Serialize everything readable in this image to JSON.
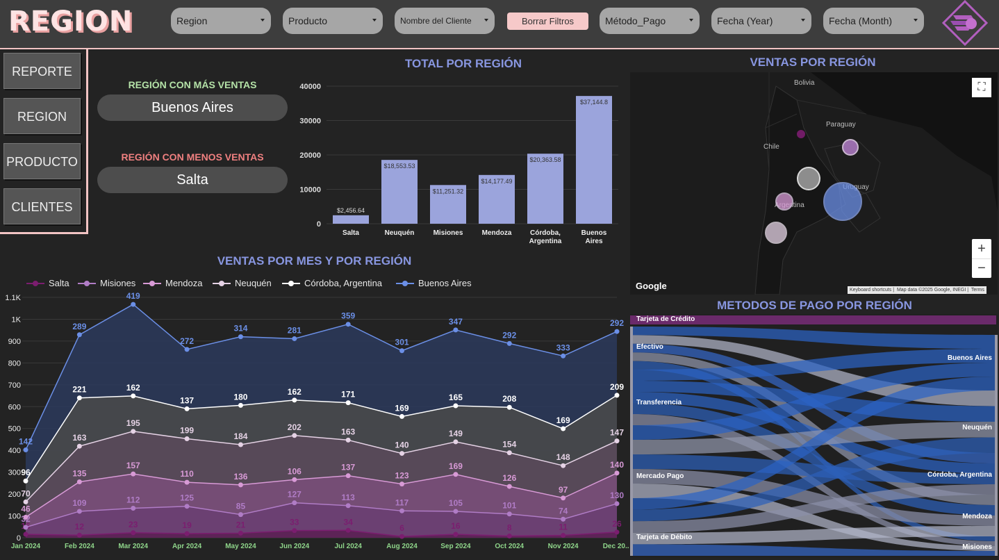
{
  "header": {
    "title": "REGION",
    "filters": [
      {
        "label": "Region"
      },
      {
        "label": "Producto"
      },
      {
        "label": "Nombre del Cliente"
      },
      {
        "label": "Método_Pago"
      },
      {
        "label": "Fecha (Year)"
      },
      {
        "label": "Fecha (Month)"
      }
    ],
    "clear_label": "Borrar Filtros"
  },
  "nav": {
    "items": [
      {
        "label": "REPORTE"
      },
      {
        "label": "REGION"
      },
      {
        "label": "PRODUCTO"
      },
      {
        "label": "CLIENTES"
      }
    ]
  },
  "kpis": {
    "top_label": "REGIÓN CON MÁS VENTAS",
    "top_value": "Buenos Aires",
    "bottom_label": "REGIÓN CON MENOS VENTAS",
    "bottom_value": "Salta",
    "top_color": "#b5e3a8",
    "bottom_color": "#f08080"
  },
  "map": {
    "title": "VENTAS POR REGIÓN",
    "labels": {
      "bolivia": "Bolivia",
      "paraguay": "Paraguay",
      "chile": "Chile",
      "argentina": "Argentina",
      "uruguay": "Uruguay"
    },
    "google": "Google",
    "footer": [
      "Keyboard shortcuts",
      "Map data ©2025 Google, INEGI",
      "Terms"
    ],
    "zoom_in": "+",
    "zoom_out": "−"
  },
  "chart_data": [
    {
      "type": "bar",
      "title": "TOTAL POR REGIÓN",
      "categories": [
        "Salta",
        "Neuquén",
        "Misiones",
        "Mendoza",
        "Córdoba, Argentina",
        "Buenos Aires"
      ],
      "values": [
        2456.64,
        18553.53,
        11251.32,
        14177.49,
        20363.58,
        37144.8
      ],
      "data_labels": [
        "$2,456.64",
        "$18,553.53",
        "$11,251.32",
        "$14,177.49",
        "$20,363.58",
        "$37,144.8"
      ],
      "yticks": [
        "0",
        "10000",
        "20000",
        "30000",
        "40000"
      ],
      "ylim": [
        0,
        40000
      ],
      "bar_color": "#9ba4dc"
    },
    {
      "type": "area",
      "title": "VENTAS POR MES Y POR REGIÓN",
      "categories": [
        "Jan 2024",
        "Feb 2024",
        "Mar 2024",
        "Apr 2024",
        "May 2024",
        "Jun 2024",
        "Jul 2024",
        "Aug 2024",
        "Sep 2024",
        "Oct 2024",
        "Nov 2024",
        "Dec 20..."
      ],
      "stacked": true,
      "ylim": [
        0,
        1100
      ],
      "yticks": [
        "0",
        "100",
        "200",
        "300",
        "400",
        "500",
        "600",
        "700",
        "800",
        "900",
        "1K",
        "1.1K"
      ],
      "series": [
        {
          "name": "Salta",
          "color": "#7b1d6f",
          "values": [
            16,
            12,
            23,
            19,
            21,
            33,
            34,
            6,
            16,
            8,
            11,
            26
          ]
        },
        {
          "name": "Misiones",
          "color": "#b07cc6",
          "values": [
            32,
            109,
            112,
            125,
            85,
            127,
            113,
            117,
            105,
            101,
            74,
            130
          ]
        },
        {
          "name": "Mendoza",
          "color": "#d89ad6",
          "values": [
            46,
            135,
            157,
            110,
            136,
            106,
            137,
            123,
            169,
            126,
            97,
            140
          ]
        },
        {
          "name": "Neuquén",
          "color": "#e5d2e5",
          "values": [
            70,
            163,
            195,
            199,
            184,
            202,
            163,
            140,
            149,
            154,
            148,
            147
          ]
        },
        {
          "name": "Córdoba, Argentina",
          "color": "#ffffff",
          "values": [
            96,
            221,
            162,
            137,
            180,
            162,
            171,
            169,
            165,
            208,
            169,
            209
          ]
        },
        {
          "name": "Buenos Aires",
          "color": "#6b8fe6",
          "values": [
            142,
            289,
            419,
            272,
            314,
            281,
            359,
            301,
            347,
            292,
            333,
            292
          ]
        }
      ]
    },
    {
      "type": "sankey",
      "title": "METODOS DE PAGO POR REGIÓN",
      "sources": [
        "Tarjeta de Crédito",
        "Efectivo",
        "Transferencia",
        "Mercado Pago",
        "Tarjeta de Débito"
      ],
      "targets": [
        "Buenos Aires",
        "Neuquén",
        "Córdoba, Argentina",
        "Mendoza",
        "Misiones"
      ]
    }
  ]
}
